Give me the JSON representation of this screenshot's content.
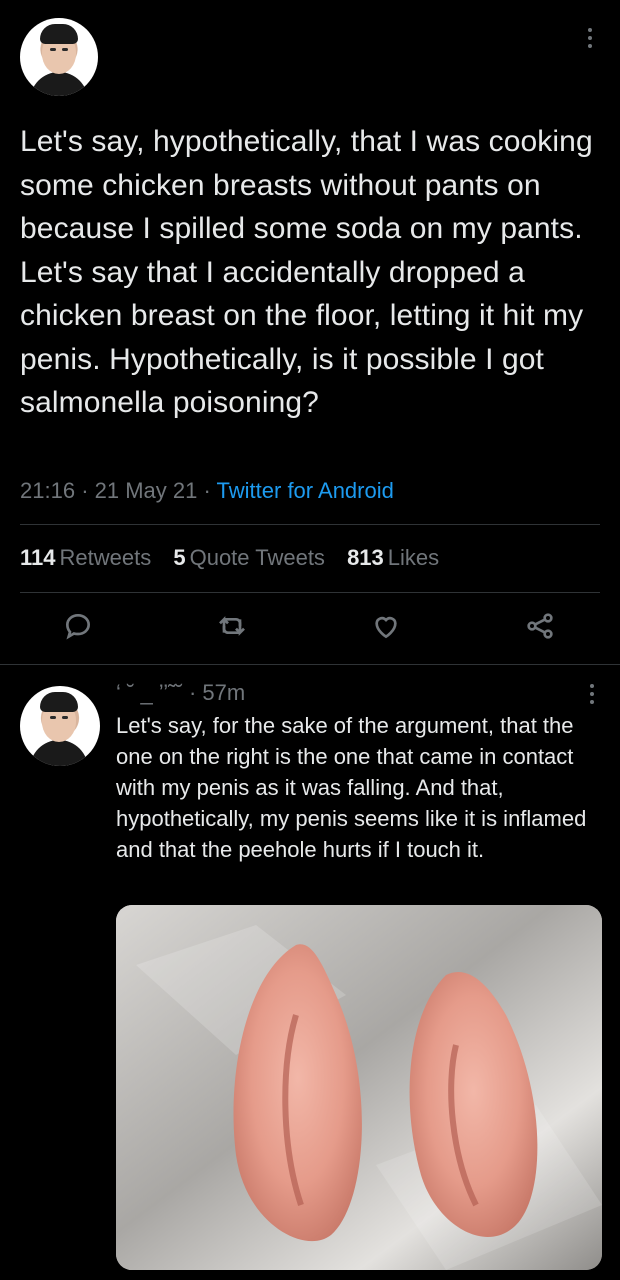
{
  "main_tweet": {
    "avatar_icon": "profile-avatar",
    "text": "Let's say, hypothetically, that I was cooking some chicken breasts without pants on because I spilled some soda on my pants. Let's say that I accidentally dropped a chicken breast on the floor, letting it hit my penis. Hypothetically, is it possible I got salmonella poisoning?",
    "time": "21:16",
    "date": "21 May 21",
    "source": "Twitter for Android",
    "retweets_count": "114",
    "retweets_label": "Retweets",
    "quotes_count": "5",
    "quotes_label": "Quote Tweets",
    "likes_count": "813",
    "likes_label": "Likes"
  },
  "actions": [
    "reply-icon",
    "retweet-icon",
    "like-icon",
    "share-icon"
  ],
  "reply": {
    "handle_fragment": "‘ ˘ _ ’’˜˘",
    "age": "57m",
    "text": "Let's say, for the sake of the argument, that the one on the right is the one that came in contact with my penis as it was falling. And that, hypothetically, my penis seems like it is inflamed and that the peehole hurts if I touch it."
  },
  "colors": {
    "background": "#000000",
    "text": "#e7e9ea",
    "secondary": "#71767b",
    "link": "#1d9bf0",
    "divider": "#2f3336"
  }
}
